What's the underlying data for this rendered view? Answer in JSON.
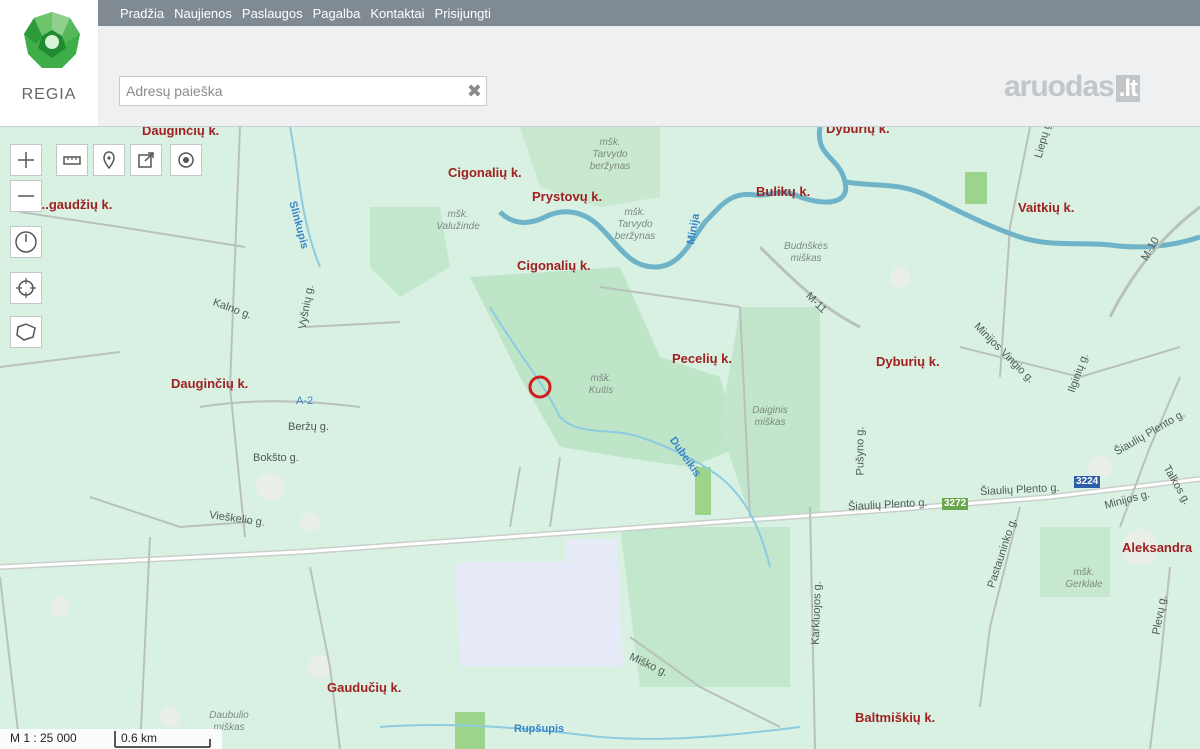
{
  "nav": {
    "items": [
      "Pradžia",
      "Naujienos",
      "Paslaugos",
      "Pagalba",
      "Kontaktai",
      "Prisijungti"
    ]
  },
  "logo": {
    "text": "REGIA"
  },
  "search": {
    "placeholder": "Adresų paieška",
    "value": "",
    "clear_icon": "close-icon"
  },
  "brand": {
    "name": "aruodas",
    "tld": ".lt"
  },
  "map": {
    "places": [
      "Dauginčių k.",
      "Cigonalių k.",
      "Prystovų k.",
      "Bulikų k.",
      "Dyburių k.",
      "Vaitkių k.",
      "Cigonalių k.",
      "Dauginčių k.",
      "Pecelių k.",
      "Dyburių k.",
      "Aleksandra",
      "Gaudučių k.",
      "Baltmiškių k.",
      "...gaudžių k."
    ],
    "forests": [
      "mšk. Tarvydo beržynas",
      "mšk. Valužinde",
      "mšk. Tarvydo beržynas",
      "Budnškės miškas",
      "mšk. Kuitis",
      "Daiginis miškas",
      "mšk. Gerklale",
      "Daubulio miškas"
    ],
    "roads": [
      "Kalno g.",
      "Vyšnių g.",
      "Beržų g.",
      "Bokšto g.",
      "Vieškelio g.",
      "Šiaulių Plento g.",
      "Šiaulių Plento g.",
      "Pušyno g.",
      "Karkluojos g.",
      "Pastauninko g.",
      "Miško g.",
      "Minijos Vingio g.",
      "Ilginių g.",
      "Šiaulių Plento g.",
      "Talkos g.",
      "Minijos g.",
      "Plevų g.",
      "Liepų g."
    ],
    "water": [
      "Slinkupis",
      "Minija",
      "Dubeikis",
      "Rupšupis"
    ],
    "highways": [
      "A-2",
      "M-11",
      "M-10"
    ],
    "route_shields": [
      "3224",
      "3272"
    ],
    "shield_colors": {
      "3224": "#2c5fa8",
      "3272": "#6aa84f",
      "A-2": "#3a86c8"
    },
    "marker_color": "#d31c1c"
  },
  "scale": {
    "ratio": "M 1 : 25 000",
    "distance": "0.6 km"
  },
  "tools": [
    "zoom-in-icon",
    "zoom-out-icon",
    "measure-ruler-icon",
    "map-pin-icon",
    "share-icon",
    "target-icon",
    "clock-icon",
    "crosshair-icon",
    "shape-icon"
  ]
}
